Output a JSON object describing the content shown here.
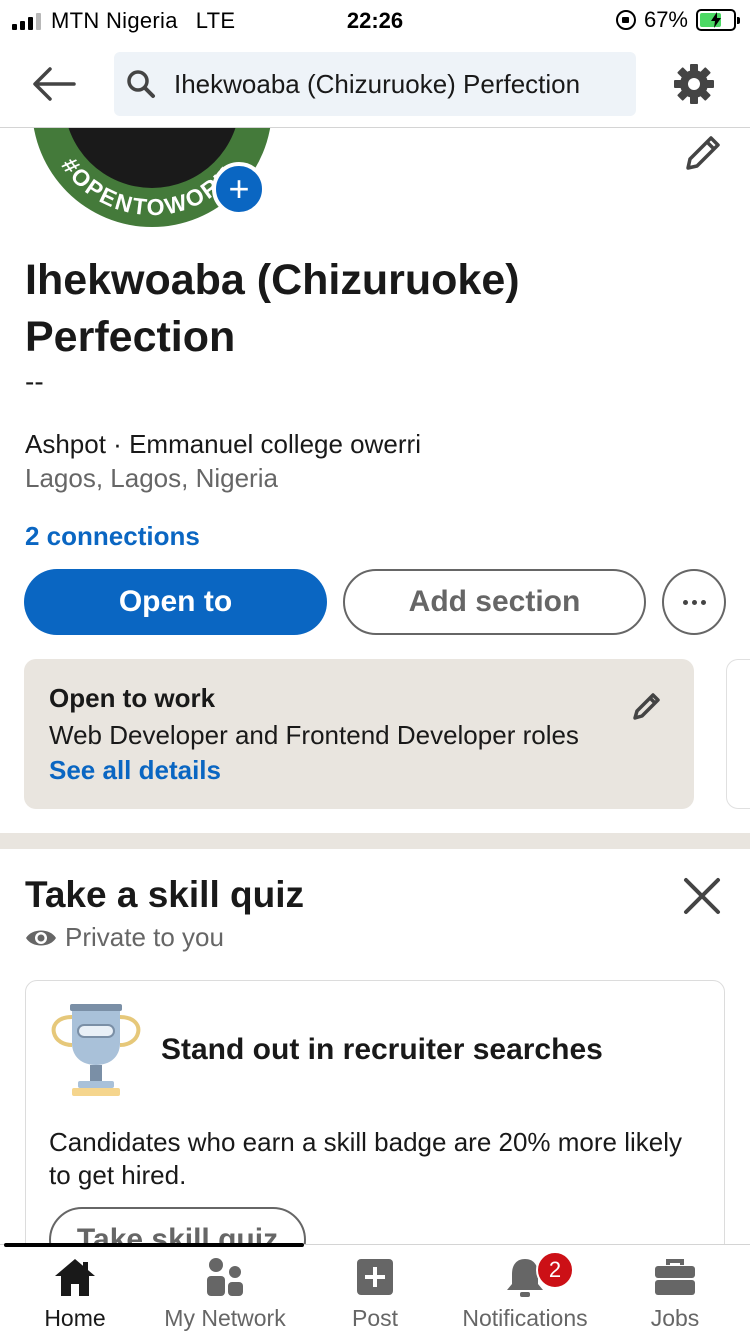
{
  "status_bar": {
    "carrier": "MTN Nigeria",
    "network": "LTE",
    "time": "22:26",
    "battery": "67%",
    "battery_level": 0.67
  },
  "top_nav": {
    "back_icon": "back-arrow-icon",
    "search_text": "Ihekwoaba (Chizuruoke) Perfection",
    "settings_icon": "gear-icon"
  },
  "profile": {
    "badge_text": "#OPENTOWORK",
    "name": "Ihekwoaba (Chizuruoke) Perfection",
    "headline": "--",
    "company": "Ashpot",
    "education": "Emmanuel college owerri",
    "separator": " · ",
    "location": "Lagos, Lagos, Nigeria",
    "connections": "2 connections"
  },
  "actions": {
    "open_to": "Open to",
    "add_section": "Add section",
    "more_icon": "ellipsis-icon"
  },
  "open_to_work": {
    "title": "Open to work",
    "description": "Web Developer and Frontend Developer roles",
    "link": "See all details"
  },
  "skill_quiz": {
    "title": "Take a skill quiz",
    "privacy": "Private to you",
    "card_headline": "Stand out in recruiter searches",
    "card_body": "Candidates who earn a skill badge are 20% more likely to get hired.",
    "button": "Take skill quiz"
  },
  "bottom_nav": {
    "items": [
      {
        "label": "Home",
        "icon": "home-icon",
        "active": true
      },
      {
        "label": "My Network",
        "icon": "network-icon",
        "active": false
      },
      {
        "label": "Post",
        "icon": "post-icon",
        "active": false
      },
      {
        "label": "Notifications",
        "icon": "bell-icon",
        "active": false,
        "badge": "2"
      },
      {
        "label": "Jobs",
        "icon": "briefcase-icon",
        "active": false
      }
    ]
  },
  "colors": {
    "brand_blue": "#0a66c2",
    "otw_green": "#447a3a",
    "card_bg": "#e9e5df",
    "badge_red": "#cc1016"
  }
}
